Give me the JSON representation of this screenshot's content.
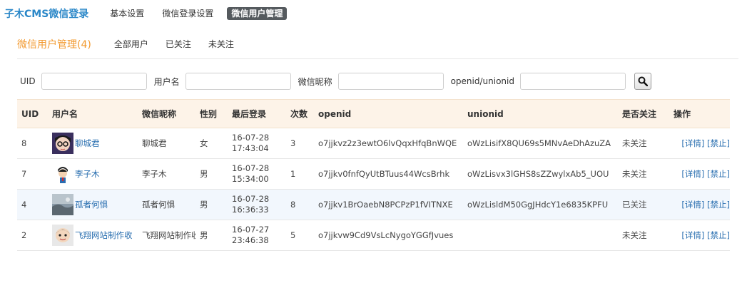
{
  "header": {
    "brand": "子木CMS微信登录",
    "nav": [
      "基本设置",
      "微信登录设置",
      "微信用户管理"
    ],
    "active_index": 2
  },
  "subheader": {
    "title": "微信用户管理(4)",
    "filters": [
      "全部用户",
      "已关注",
      "未关注"
    ]
  },
  "search": {
    "uid_label": "UID",
    "username_label": "用户名",
    "nickname_label": "微信昵称",
    "openid_label": "openid/unionid",
    "search_icon": "magnifier-icon"
  },
  "table": {
    "columns": {
      "uid": "UID",
      "username": "用户名",
      "nickname": "微信昵称",
      "gender": "性别",
      "last_login": "最后登录",
      "count": "次数",
      "openid": "openid",
      "unionid": "unionid",
      "follow": "是否关注",
      "action": "操作"
    },
    "rows": [
      {
        "uid": "8",
        "username": "聊城君",
        "nickname": "聊城君",
        "gender": "女",
        "date": "16-07-28",
        "time": "17:43:04",
        "count": "3",
        "openid": "o7jjkvz2z3ewtO6lvQqxHfqBnWQE",
        "unionid": "oWzLisifX8QU69s5MNvAeDhAzuZA",
        "follow": "未关注",
        "detail": "[详情]",
        "ban": "[禁止]"
      },
      {
        "uid": "7",
        "username": "李子木",
        "nickname": "李子木",
        "gender": "男",
        "date": "16-07-28",
        "time": "15:34:00",
        "count": "1",
        "openid": "o7jjkv0fnfQyUtBTuus44WcsBrhk",
        "unionid": "oWzLisvx3lGHS8sZZwylxAb5_UOU",
        "follow": "未关注",
        "detail": "[详情]",
        "ban": "[禁止]"
      },
      {
        "uid": "4",
        "username": "孤者何惧",
        "nickname": "孤者何惧",
        "gender": "男",
        "date": "16-07-28",
        "time": "16:36:33",
        "count": "8",
        "openid": "o7jjkv1BrOaebN8PCPzP1fVITNXE",
        "unionid": "oWzLisldM50GgJHdcY1e6835KPFU",
        "follow": "已关注",
        "detail": "[详情]",
        "ban": "[禁止]"
      },
      {
        "uid": "2",
        "username": "飞翔网站制作收",
        "nickname": "飞翔网站制作收",
        "gender": "男",
        "date": "16-07-27",
        "time": "23:46:38",
        "count": "5",
        "openid": "o7jjkvw9Cd9VsLcNygoYGGfJvues",
        "unionid": "",
        "follow": "未关注",
        "detail": "[详情]",
        "ban": "[禁止]"
      }
    ]
  },
  "colors": {
    "brand": "#2a87c8",
    "accent": "#f2992e",
    "header_bg": "#fdf3e8",
    "followed": "#d9262a",
    "link": "#2a6fb0"
  }
}
